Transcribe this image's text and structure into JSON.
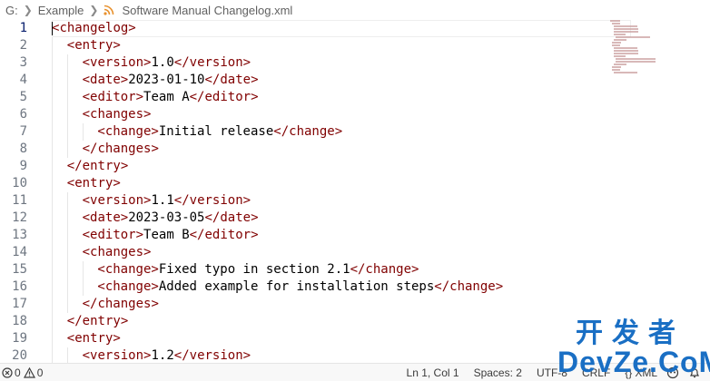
{
  "breadcrumb": {
    "drive": "G:",
    "folder": "Example",
    "file": "Software Manual Changelog.xml"
  },
  "editor": {
    "active_line": 1,
    "lines": [
      {
        "n": "1",
        "indent": 0,
        "parts": [
          [
            "b",
            "<"
          ],
          [
            "t",
            "changelog"
          ],
          [
            "b",
            ">"
          ]
        ]
      },
      {
        "n": "2",
        "indent": 1,
        "parts": [
          [
            "b",
            "<"
          ],
          [
            "t",
            "entry"
          ],
          [
            "b",
            ">"
          ]
        ]
      },
      {
        "n": "3",
        "indent": 2,
        "parts": [
          [
            "b",
            "<"
          ],
          [
            "t",
            "version"
          ],
          [
            "b",
            ">"
          ],
          [
            "x",
            "1.0"
          ],
          [
            "b",
            "</"
          ],
          [
            "t",
            "version"
          ],
          [
            "b",
            ">"
          ]
        ]
      },
      {
        "n": "4",
        "indent": 2,
        "parts": [
          [
            "b",
            "<"
          ],
          [
            "t",
            "date"
          ],
          [
            "b",
            ">"
          ],
          [
            "x",
            "2023-01-10"
          ],
          [
            "b",
            "</"
          ],
          [
            "t",
            "date"
          ],
          [
            "b",
            ">"
          ]
        ]
      },
      {
        "n": "5",
        "indent": 2,
        "parts": [
          [
            "b",
            "<"
          ],
          [
            "t",
            "editor"
          ],
          [
            "b",
            ">"
          ],
          [
            "x",
            "Team A"
          ],
          [
            "b",
            "</"
          ],
          [
            "t",
            "editor"
          ],
          [
            "b",
            ">"
          ]
        ]
      },
      {
        "n": "6",
        "indent": 2,
        "parts": [
          [
            "b",
            "<"
          ],
          [
            "t",
            "changes"
          ],
          [
            "b",
            ">"
          ]
        ]
      },
      {
        "n": "7",
        "indent": 3,
        "parts": [
          [
            "b",
            "<"
          ],
          [
            "t",
            "change"
          ],
          [
            "b",
            ">"
          ],
          [
            "x",
            "Initial release"
          ],
          [
            "b",
            "</"
          ],
          [
            "t",
            "change"
          ],
          [
            "b",
            ">"
          ]
        ]
      },
      {
        "n": "8",
        "indent": 2,
        "parts": [
          [
            "b",
            "</"
          ],
          [
            "t",
            "changes"
          ],
          [
            "b",
            ">"
          ]
        ]
      },
      {
        "n": "9",
        "indent": 1,
        "parts": [
          [
            "b",
            "</"
          ],
          [
            "t",
            "entry"
          ],
          [
            "b",
            ">"
          ]
        ]
      },
      {
        "n": "10",
        "indent": 1,
        "parts": [
          [
            "b",
            "<"
          ],
          [
            "t",
            "entry"
          ],
          [
            "b",
            ">"
          ]
        ]
      },
      {
        "n": "11",
        "indent": 2,
        "parts": [
          [
            "b",
            "<"
          ],
          [
            "t",
            "version"
          ],
          [
            "b",
            ">"
          ],
          [
            "x",
            "1.1"
          ],
          [
            "b",
            "</"
          ],
          [
            "t",
            "version"
          ],
          [
            "b",
            ">"
          ]
        ]
      },
      {
        "n": "12",
        "indent": 2,
        "parts": [
          [
            "b",
            "<"
          ],
          [
            "t",
            "date"
          ],
          [
            "b",
            ">"
          ],
          [
            "x",
            "2023-03-05"
          ],
          [
            "b",
            "</"
          ],
          [
            "t",
            "date"
          ],
          [
            "b",
            ">"
          ]
        ]
      },
      {
        "n": "13",
        "indent": 2,
        "parts": [
          [
            "b",
            "<"
          ],
          [
            "t",
            "editor"
          ],
          [
            "b",
            ">"
          ],
          [
            "x",
            "Team B"
          ],
          [
            "b",
            "</"
          ],
          [
            "t",
            "editor"
          ],
          [
            "b",
            ">"
          ]
        ]
      },
      {
        "n": "14",
        "indent": 2,
        "parts": [
          [
            "b",
            "<"
          ],
          [
            "t",
            "changes"
          ],
          [
            "b",
            ">"
          ]
        ]
      },
      {
        "n": "15",
        "indent": 3,
        "parts": [
          [
            "b",
            "<"
          ],
          [
            "t",
            "change"
          ],
          [
            "b",
            ">"
          ],
          [
            "x",
            "Fixed typo in section 2.1"
          ],
          [
            "b",
            "</"
          ],
          [
            "t",
            "change"
          ],
          [
            "b",
            ">"
          ]
        ]
      },
      {
        "n": "16",
        "indent": 3,
        "parts": [
          [
            "b",
            "<"
          ],
          [
            "t",
            "change"
          ],
          [
            "b",
            ">"
          ],
          [
            "x",
            "Added example for installation steps"
          ],
          [
            "b",
            "</"
          ],
          [
            "t",
            "change"
          ],
          [
            "b",
            ">"
          ]
        ]
      },
      {
        "n": "17",
        "indent": 2,
        "parts": [
          [
            "b",
            "</"
          ],
          [
            "t",
            "changes"
          ],
          [
            "b",
            ">"
          ]
        ]
      },
      {
        "n": "18",
        "indent": 1,
        "parts": [
          [
            "b",
            "</"
          ],
          [
            "t",
            "entry"
          ],
          [
            "b",
            ">"
          ]
        ]
      },
      {
        "n": "19",
        "indent": 1,
        "parts": [
          [
            "b",
            "<"
          ],
          [
            "t",
            "entry"
          ],
          [
            "b",
            ">"
          ]
        ]
      },
      {
        "n": "20",
        "indent": 2,
        "parts": [
          [
            "b",
            "<"
          ],
          [
            "t",
            "version"
          ],
          [
            "b",
            ">"
          ],
          [
            "x",
            "1.2"
          ],
          [
            "b",
            "</"
          ],
          [
            "t",
            "version"
          ],
          [
            "b",
            ">"
          ]
        ]
      }
    ]
  },
  "statusbar": {
    "errors": "0",
    "warnings": "0",
    "position": "Ln 1, Col 1",
    "spaces": "Spaces: 2",
    "encoding": "UTF-8",
    "eol": "CRLF",
    "language": "XML"
  },
  "watermark": {
    "cn": "开发者",
    "en": "DevZe.CoM"
  },
  "colors": {
    "tag": "#800000",
    "text": "#000000",
    "rss": "#e8912d",
    "watermark": "#1a6fc4"
  },
  "icons": {
    "breadcrumb_separator": "chevron-right-icon",
    "file": "rss-icon",
    "errors": "error-icon",
    "warnings": "warning-icon",
    "language_braces": "braces-icon",
    "feedback": "copilot-icon",
    "notifications": "bell-icon"
  }
}
